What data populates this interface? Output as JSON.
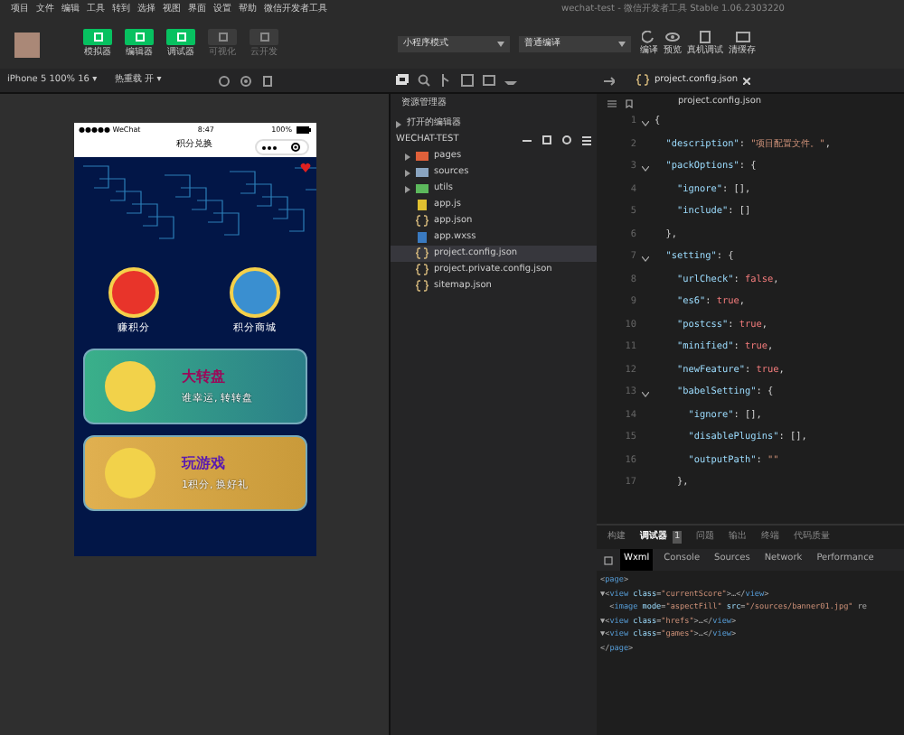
{
  "menu": [
    "项目",
    "文件",
    "编辑",
    "工具",
    "转到",
    "选择",
    "视图",
    "界面",
    "设置",
    "帮助",
    "微信开发者工具"
  ],
  "window": {
    "title": "wechat-test - 微信开发者工具 Stable 1.06.2303220"
  },
  "toolbar": {
    "left_buttons": [
      {
        "label": "模拟器",
        "on": true
      },
      {
        "label": "编辑器",
        "on": true
      },
      {
        "label": "调试器",
        "on": true
      },
      {
        "label": "可视化",
        "on": false
      },
      {
        "label": "云开发",
        "on": false
      }
    ],
    "mode": "小程序模式",
    "compile": "普通编译",
    "right_buttons": [
      "编译",
      "预览",
      "真机调试",
      "清缓存"
    ]
  },
  "simulator": {
    "device": "iPhone 5 100% 16 ▾",
    "hot_reload": "热重载 开 ▾",
    "status": {
      "carrier": "●●●●● WeChat",
      "time": "8:47",
      "battery": "100%"
    },
    "nav_title": "积分兑换",
    "shortcuts": [
      {
        "label": "赚积分"
      },
      {
        "label": "积分商城"
      }
    ],
    "cards": [
      {
        "kind": "green",
        "title": "大转盘",
        "subtitle": "谁幸运, 转转盘"
      },
      {
        "kind": "gold",
        "title": "玩游戏",
        "subtitle": "1积分, 换好礼"
      }
    ]
  },
  "explorer": {
    "title": "资源管理器",
    "open_editors": "打开的编辑器",
    "project": "WECHAT-TEST",
    "items": [
      {
        "kind": "pages",
        "name": "pages",
        "selected": false
      },
      {
        "kind": "folder",
        "name": "sources",
        "selected": false
      },
      {
        "kind": "utils",
        "name": "utils",
        "selected": false
      },
      {
        "kind": "js",
        "name": "app.js",
        "selected": false
      },
      {
        "kind": "json",
        "name": "app.json",
        "selected": false
      },
      {
        "kind": "wxss",
        "name": "app.wxss",
        "selected": false
      },
      {
        "kind": "json",
        "name": "project.config.json",
        "selected": true
      },
      {
        "kind": "json",
        "name": "project.private.config.json",
        "selected": false
      },
      {
        "kind": "json",
        "name": "sitemap.json",
        "selected": false
      }
    ]
  },
  "editor": {
    "tab": "project.config.json",
    "breadcrumb": "project.config.json",
    "lines": [
      {
        "num": "1",
        "fold": true,
        "text": "{"
      },
      {
        "num": "2",
        "fold": false,
        "text": "  \"description\": \"项目配置文件。\","
      },
      {
        "num": "3",
        "fold": true,
        "text": "  \"packOptions\": {"
      },
      {
        "num": "4",
        "fold": false,
        "text": "    \"ignore\": [],"
      },
      {
        "num": "5",
        "fold": false,
        "text": "    \"include\": []"
      },
      {
        "num": "6",
        "fold": false,
        "text": "  },"
      },
      {
        "num": "7",
        "fold": true,
        "text": "  \"setting\": {"
      },
      {
        "num": "8",
        "fold": false,
        "text": "    \"urlCheck\": false,"
      },
      {
        "num": "9",
        "fold": false,
        "text": "    \"es6\": true,"
      },
      {
        "num": "10",
        "fold": false,
        "text": "    \"postcss\": true,"
      },
      {
        "num": "11",
        "fold": false,
        "text": "    \"minified\": true,"
      },
      {
        "num": "12",
        "fold": false,
        "text": "    \"newFeature\": true,"
      },
      {
        "num": "13",
        "fold": true,
        "text": "    \"babelSetting\": {"
      },
      {
        "num": "14",
        "fold": false,
        "text": "      \"ignore\": [],"
      },
      {
        "num": "15",
        "fold": false,
        "text": "      \"disablePlugins\": [],"
      },
      {
        "num": "16",
        "fold": false,
        "text": "      \"outputPath\": \"\""
      },
      {
        "num": "17",
        "fold": false,
        "text": "    },"
      }
    ]
  },
  "debugger": {
    "tabs": [
      {
        "label": "构建",
        "selected": false
      },
      {
        "label": "调试器",
        "selected": true
      },
      {
        "label": "问题",
        "selected": false
      },
      {
        "label": "输出",
        "selected": false
      },
      {
        "label": "终端",
        "selected": false
      },
      {
        "label": "代码质量",
        "selected": false
      }
    ],
    "badge": "1",
    "panels": [
      {
        "label": "Wxml",
        "selected": true
      },
      {
        "label": "Console",
        "selected": false
      },
      {
        "label": "Sources",
        "selected": false
      },
      {
        "label": "Network",
        "selected": false
      },
      {
        "label": "Performance",
        "selected": false
      }
    ],
    "wxml": [
      "<page>",
      "▼<view class=\"currentScore\">…</view>",
      "  <image mode=\"aspectFill\" src=\"/sources/banner01.jpg\" re",
      "▼<view class=\"hrefs\">…</view>",
      "▼<view class=\"games\">…</view>",
      "</page>"
    ]
  }
}
